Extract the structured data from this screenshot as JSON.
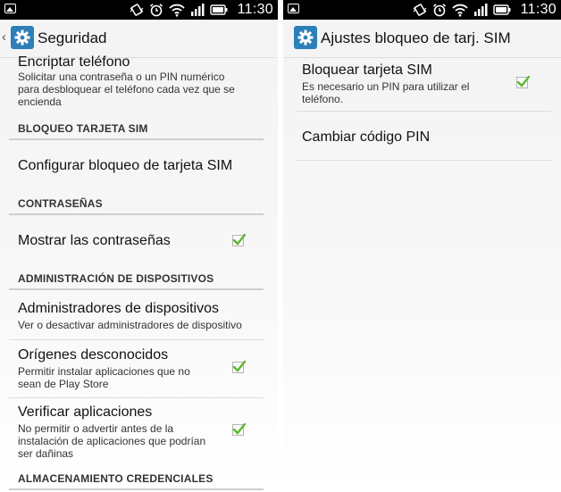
{
  "status_bar": {
    "time": "11:30"
  },
  "left": {
    "title": "Seguridad",
    "encrypt": {
      "title": "Encriptar teléfono",
      "subtitle": "Solicitar una contraseña o un PIN numérico para desbloquear el teléfono cada vez que se encienda"
    },
    "sections": {
      "sim": "BLOQUEO TARJETA SIM",
      "passwords": "CONTRASEÑAS",
      "admin": "ADMINISTRACIÓN DE DISPOSITIVOS",
      "credentials": "ALMACENAMIENTO CREDENCIALES"
    },
    "sim_config": {
      "title": "Configurar bloqueo de tarjeta SIM"
    },
    "show_passwords": {
      "title": "Mostrar las contraseñas",
      "checked": true
    },
    "device_admins": {
      "title": "Administradores de dispositivos",
      "subtitle": "Ver o desactivar administradores de dispositivo"
    },
    "unknown_sources": {
      "title": "Orígenes desconocidos",
      "subtitle": "Permitir instalar aplicaciones que no sean de Play Store",
      "checked": true
    },
    "verify_apps": {
      "title": "Verificar aplicaciones",
      "subtitle": "No permitir o advertir antes de la instalación de aplicaciones que podrían ser dañinas",
      "checked": true
    }
  },
  "right": {
    "title": "Ajustes bloqueo de tarj. SIM",
    "lock_sim": {
      "title": "Bloquear tarjeta SIM",
      "subtitle": "Es necesario un PIN para utilizar el teléfono.",
      "checked": true
    },
    "change_pin": {
      "title": "Cambiar código PIN"
    }
  },
  "colors": {
    "accent": "#2d7fb9",
    "check": "#5fb62f"
  }
}
